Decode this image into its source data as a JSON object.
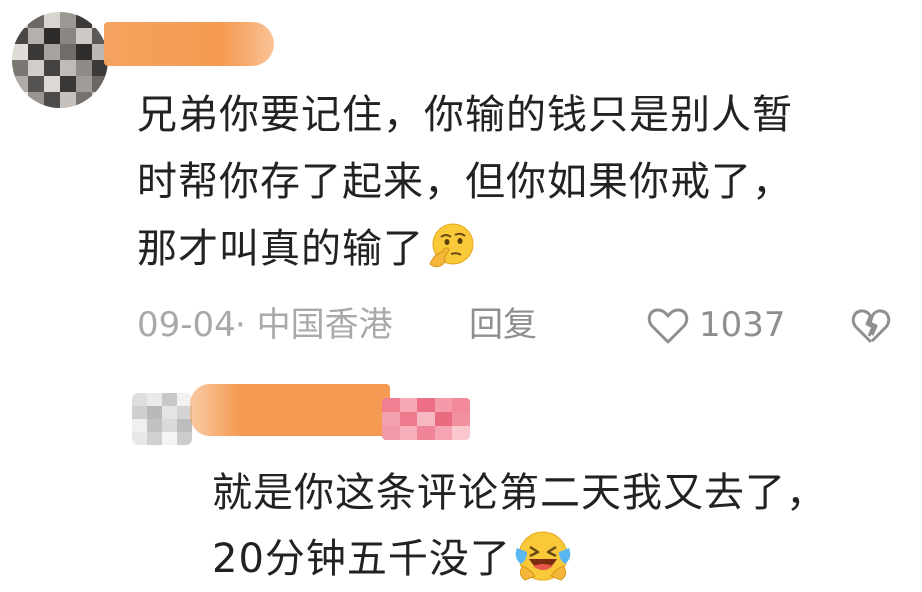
{
  "comment": {
    "lines": [
      "兄弟你要记住，你输的钱只是别人暂",
      "时帮你存了起来，但你如果你戒了，",
      "那才叫真的输了"
    ],
    "emoji": "thinking-face-emoji",
    "date": "09-04",
    "location": "· 中国香港",
    "reply_label": "回复",
    "like_count": "1037",
    "like_icon": "heart-outline-icon",
    "dislike_icon": "broken-heart-icon"
  },
  "reply": {
    "lines": [
      "就是你这条评论第二天我又去了，",
      "20分钟五千没了"
    ],
    "emoji": "laughing-crying-emoji"
  },
  "colors": {
    "redaction_orange": "#f59a52",
    "text": "#222222",
    "meta": "#a9a9a9",
    "badge_pink": "#f08c9a"
  }
}
